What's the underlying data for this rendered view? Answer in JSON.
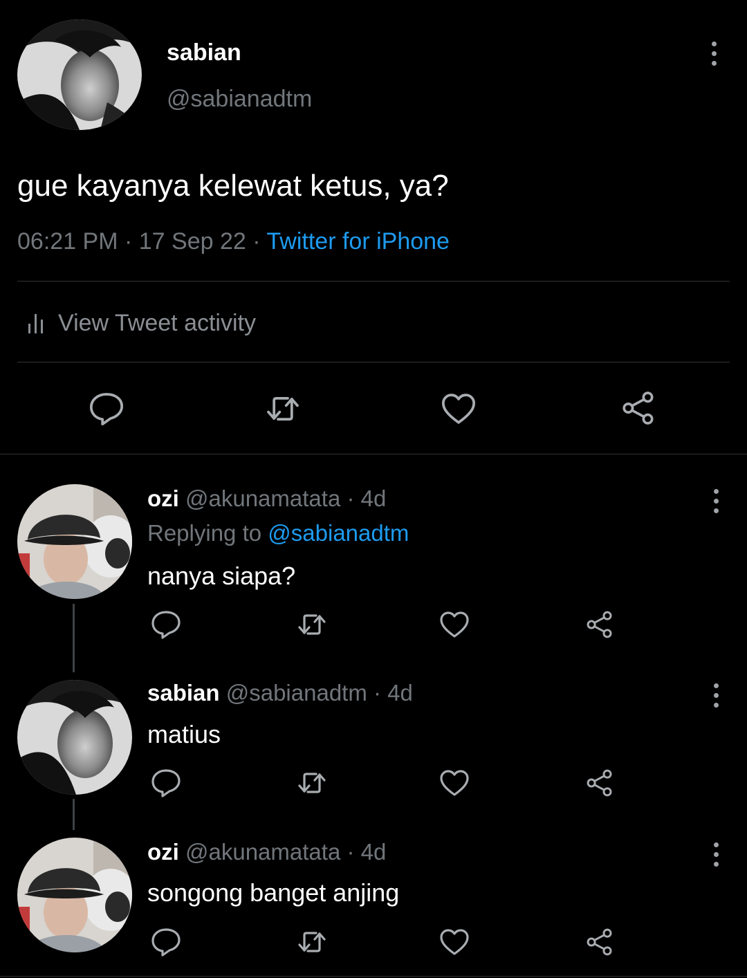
{
  "tweet": {
    "author_name": "sabian",
    "author_handle": "@sabianadtm",
    "text": "gue kayanya kelewat ketus, ya?",
    "time": "06:21 PM",
    "date": "17 Sep 22",
    "source": "Twitter for iPhone",
    "activity_label": "View Tweet activity"
  },
  "replies": [
    {
      "name": "ozi",
      "handle": "@akunamatata",
      "age": "4d",
      "replying_prefix": "Replying to",
      "replying_to": "@sabianadtm",
      "text": "nanya siapa?"
    },
    {
      "name": "sabian",
      "handle": "@sabianadtm",
      "age": "4d",
      "text": "matius"
    },
    {
      "name": "ozi",
      "handle": "@akunamatata",
      "age": "4d",
      "text": "songong banget anjing"
    }
  ],
  "colors": {
    "background": "#000000",
    "text": "#e7e9ea",
    "muted": "#71767b",
    "link": "#1d9bf0",
    "divider": "#2f3336"
  },
  "icons": [
    "more-icon",
    "bar-chart-icon",
    "reply-icon",
    "retweet-icon",
    "like-icon",
    "share-icon"
  ]
}
